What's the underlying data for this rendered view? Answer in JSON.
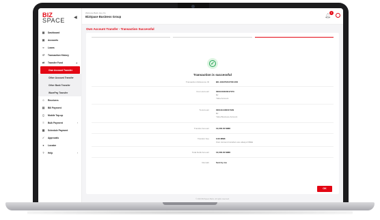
{
  "app": {
    "logo_top": "BIZ",
    "logo_bottom": "SPACE"
  },
  "header": {
    "breadcrumb": "Welcome Back, Hey Oo",
    "company": "BizSpace Business Group",
    "notification_count": "0"
  },
  "sidebar": {
    "items": [
      {
        "label": "Dashboard",
        "icon": "grid-icon"
      },
      {
        "label": "Accounts",
        "icon": "wallet-icon"
      },
      {
        "label": "Loans",
        "icon": "loan-icon"
      },
      {
        "label": "Transaction History",
        "icon": "history-icon"
      },
      {
        "label": "Transfer Fund",
        "icon": "transfer-icon"
      }
    ],
    "sub_items": [
      {
        "label": "Own Account Transfer"
      },
      {
        "label": "Other Account Transfer"
      },
      {
        "label": "Other Bank Transfer"
      },
      {
        "label": "WavePay Transfer"
      }
    ],
    "items_after": [
      {
        "label": "Receivers",
        "icon": "users-icon"
      },
      {
        "label": "Bill Payment",
        "icon": "bill-icon"
      },
      {
        "label": "Mobile Top-up",
        "icon": "phone-icon"
      },
      {
        "label": "Bulk Payment",
        "icon": "bulk-icon"
      },
      {
        "label": "Schedule Payment",
        "icon": "calendar-icon"
      },
      {
        "label": "Approvals",
        "icon": "approval-icon"
      },
      {
        "label": "Locator",
        "icon": "pin-icon"
      },
      {
        "label": "Help",
        "icon": "help-icon"
      }
    ]
  },
  "main": {
    "page_title": "Own Account Transfer - Transaction Successful",
    "status": "Transaction is successful",
    "ok_label": "OK",
    "details": [
      {
        "label": "Transaction Reference ID",
        "value": "BK-1043702107001453",
        "sub": []
      },
      {
        "label": "From Account",
        "value": "0001040400017073",
        "sub": [
          "Bz",
          "Yaba Account"
        ]
      },
      {
        "label": "To Account",
        "value": "0001111400017029",
        "sub": [
          "Bz",
          "Yaba Business Account"
        ]
      },
      {
        "label": "Transfer Amount",
        "value": "10,000.00 MMK",
        "sub": []
      },
      {
        "label": "Transfer Fee",
        "value": "0.00 MMK",
        "sub": [
          "Own Account transfers are always FREE"
        ]
      },
      {
        "label": "Total Debit Amount",
        "value": "10,000.00 MMK",
        "sub": []
      },
      {
        "label": "Remark",
        "value": "Sent by me",
        "sub": []
      }
    ]
  },
  "footer": {
    "text": "© 2023 BizSpace Bank. All rights reserved."
  },
  "colors": {
    "brand": "#e30613",
    "success": "#23a455"
  }
}
